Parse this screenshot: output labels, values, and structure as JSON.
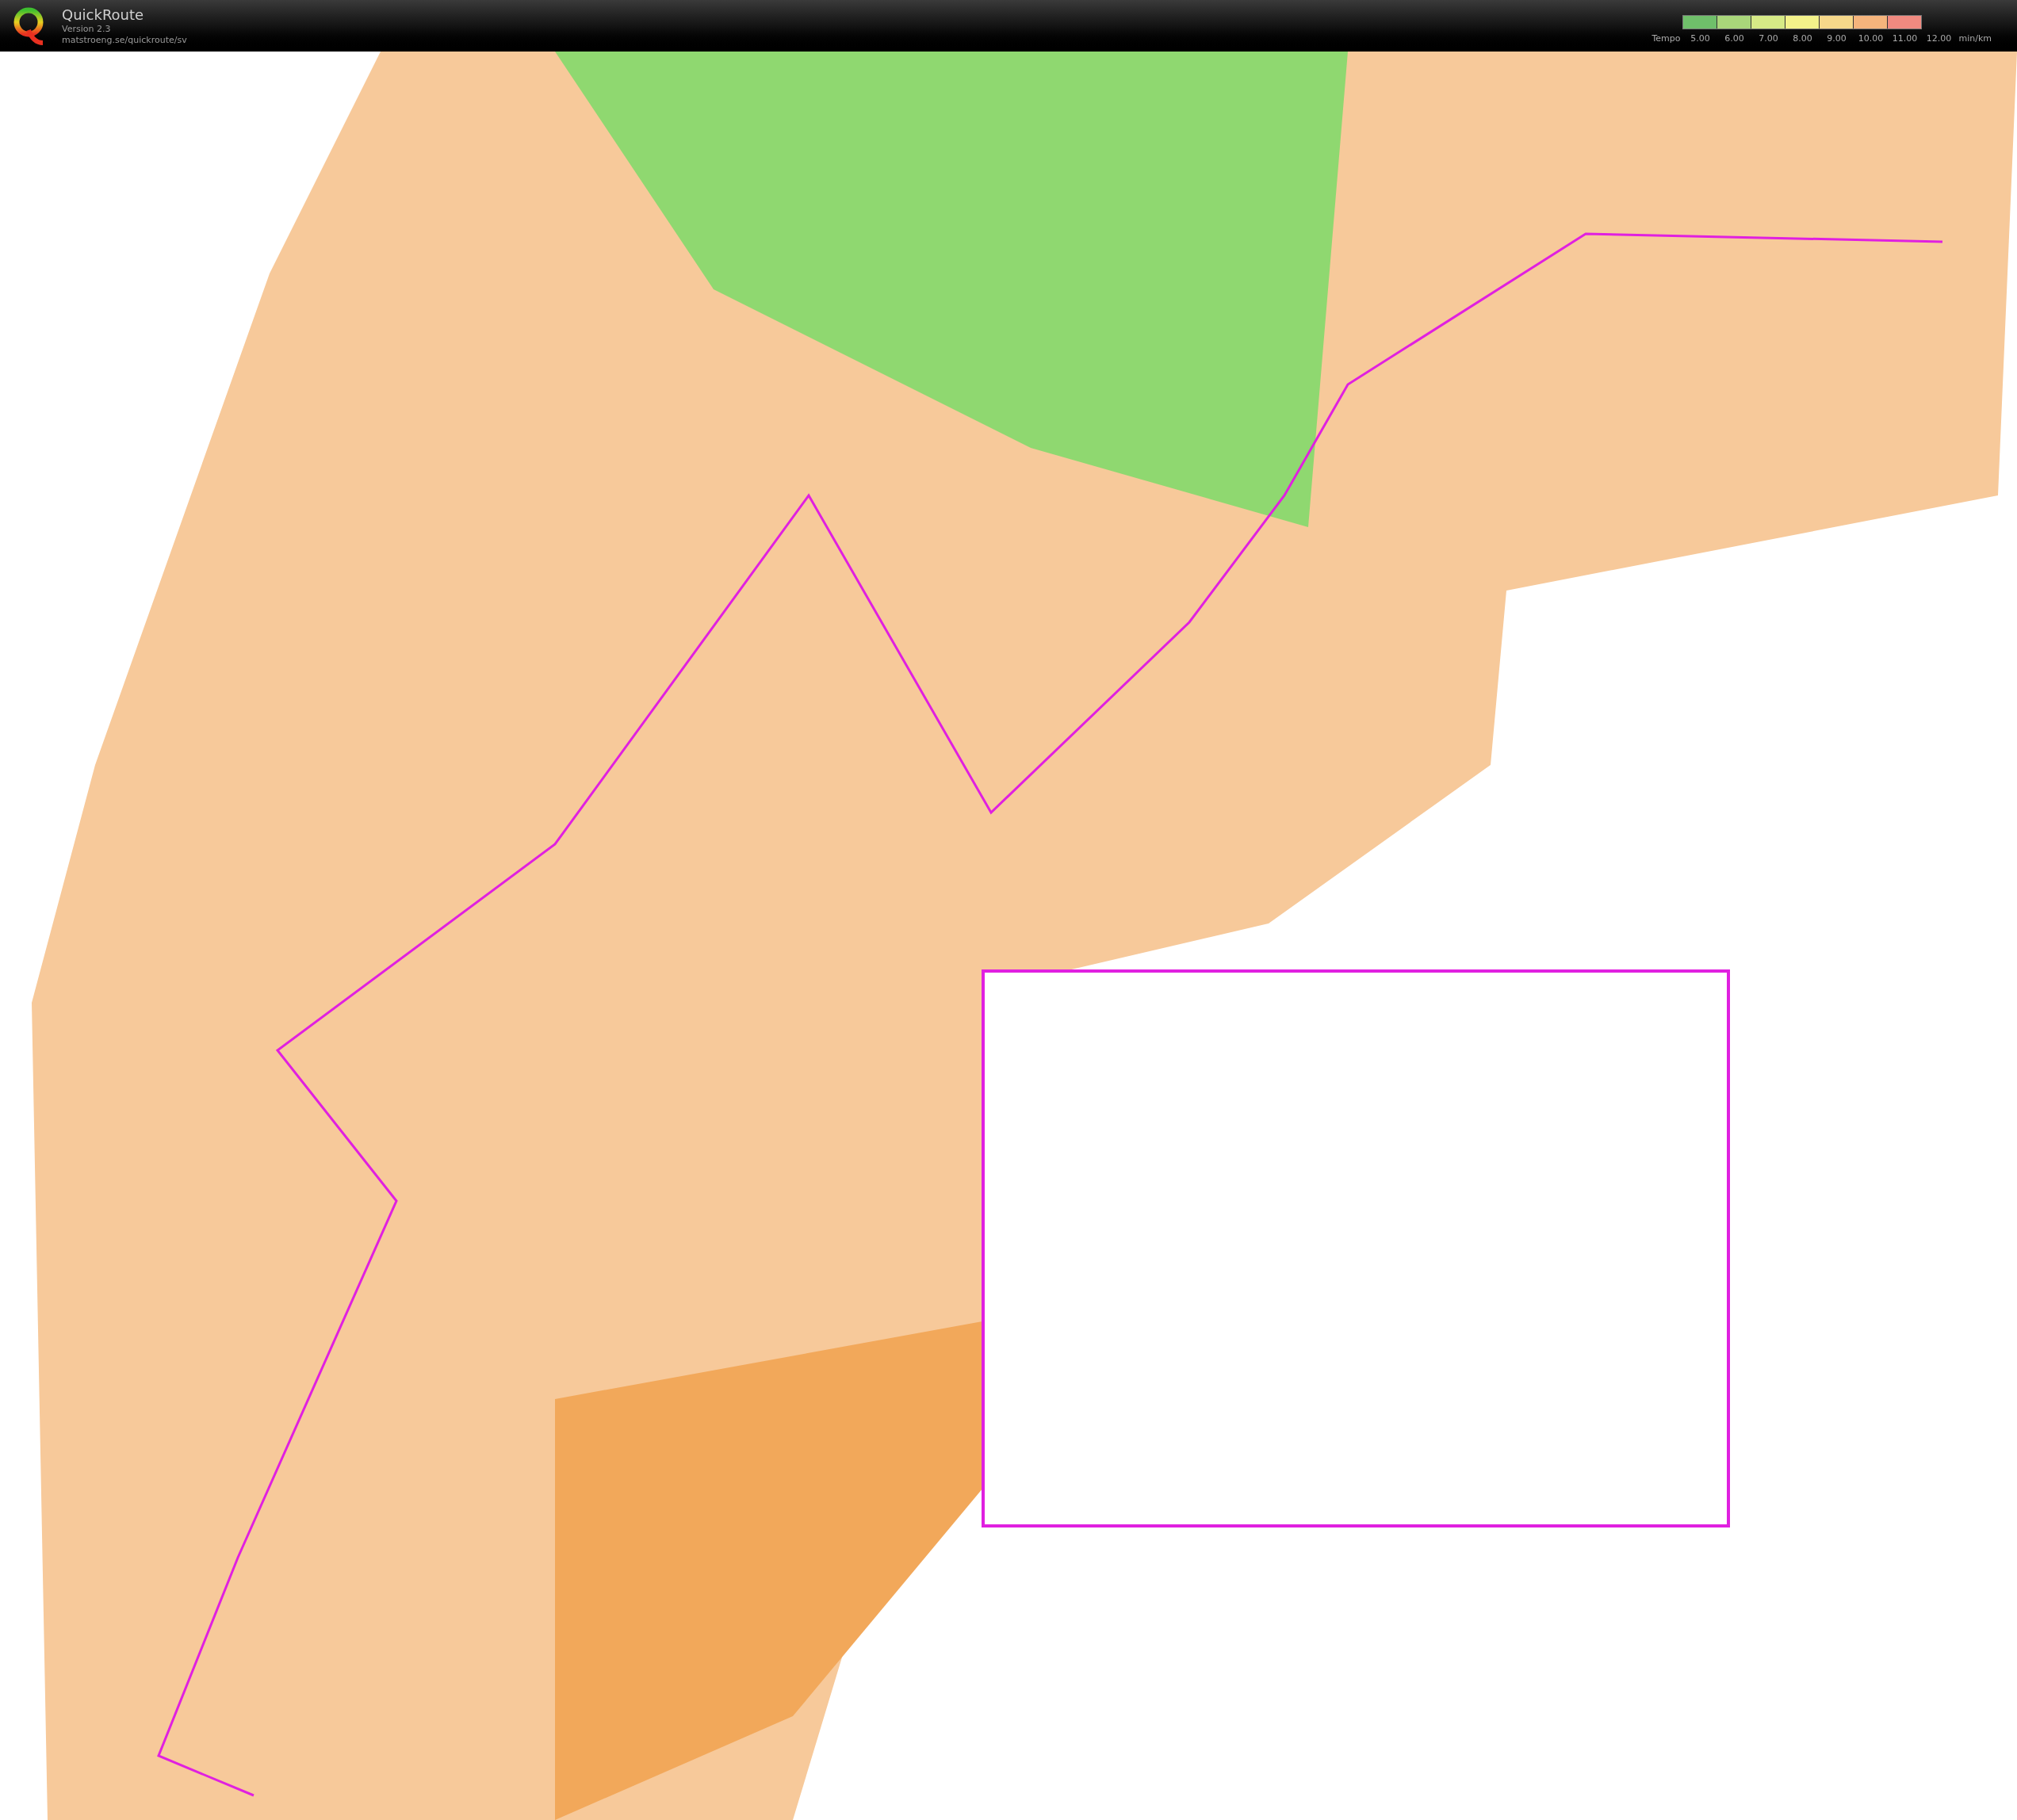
{
  "app": {
    "title": "QuickRoute",
    "version": "Version 2.3",
    "url": "matstroeng.se/quickroute/sv"
  },
  "tempo_legend": {
    "label": "Tempo",
    "values": [
      "5.00",
      "6.00",
      "7.00",
      "8.00",
      "9.00",
      "10.00",
      "11.00",
      "12.00"
    ],
    "unit": "min/km"
  }
}
